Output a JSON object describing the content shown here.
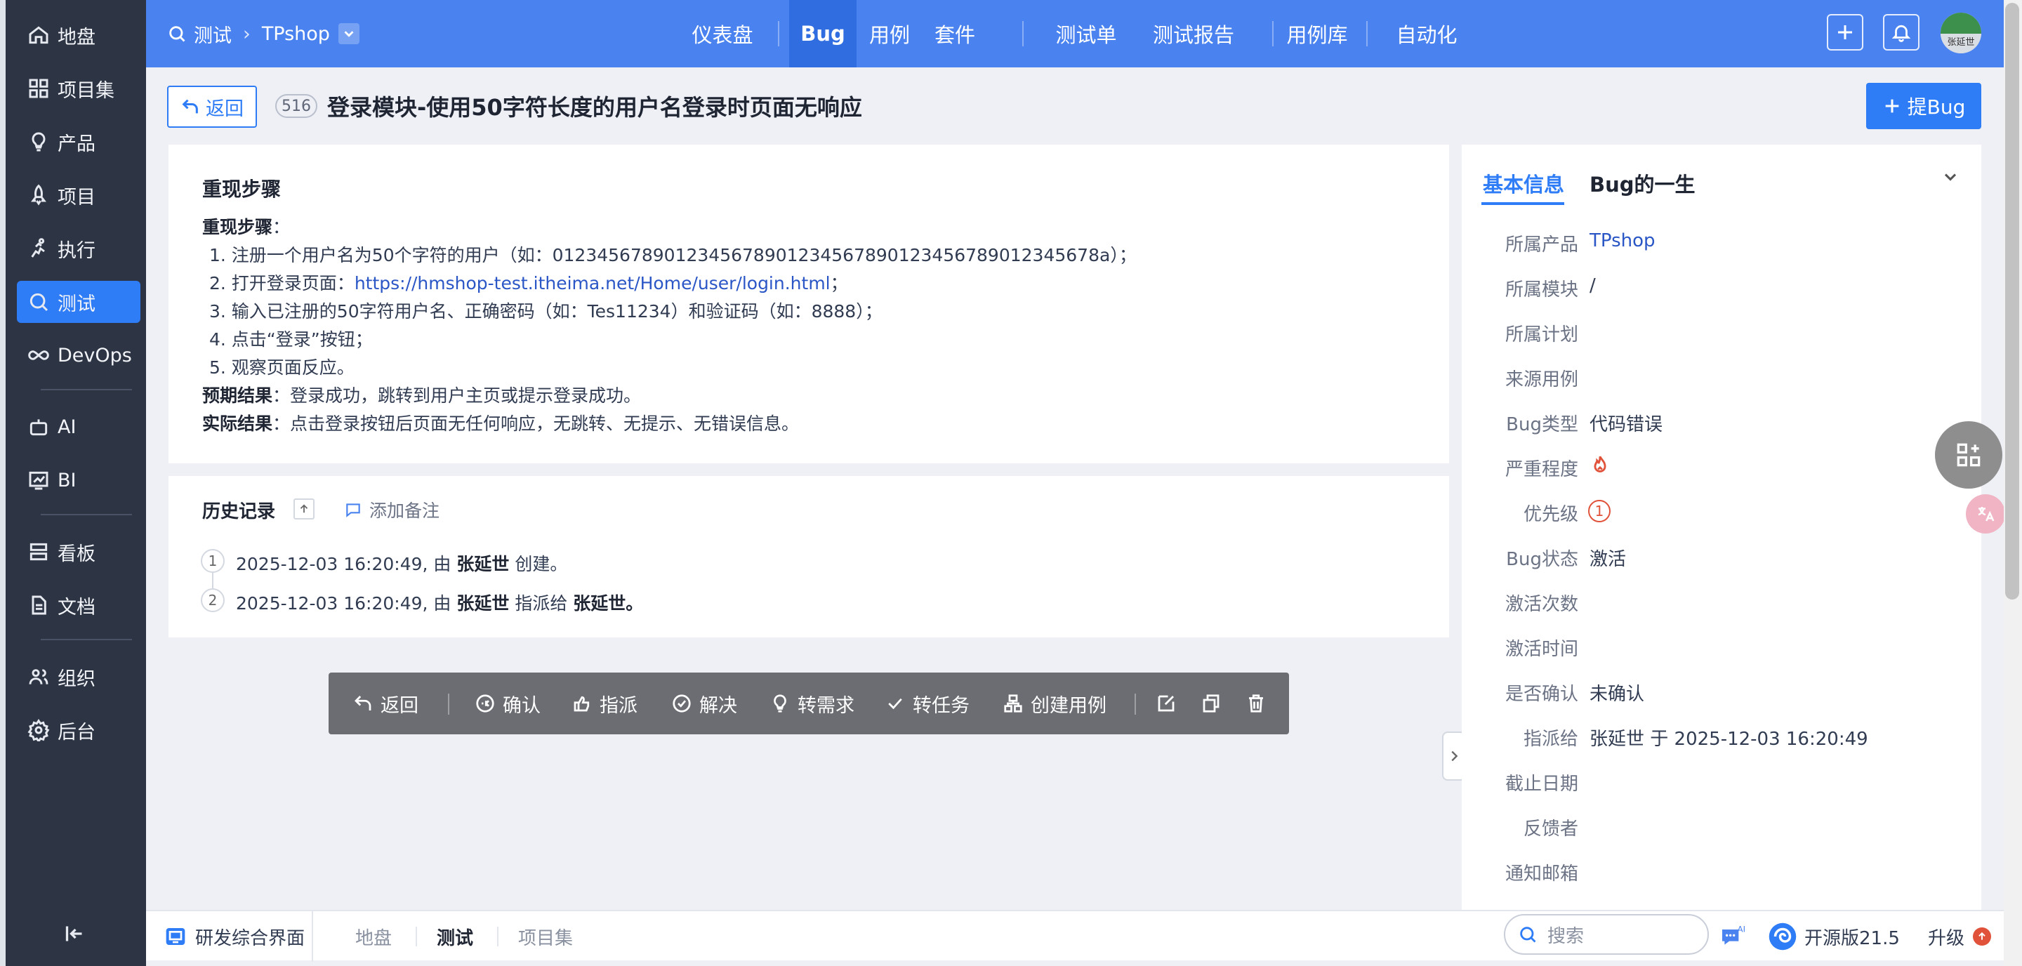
{
  "sidebar": {
    "items": [
      {
        "label": "地盘",
        "icon": "home-icon"
      },
      {
        "label": "项目集",
        "icon": "grid-icon"
      },
      {
        "label": "产品",
        "icon": "lightbulb-icon"
      },
      {
        "label": "项目",
        "icon": "rocket-icon"
      },
      {
        "label": "执行",
        "icon": "run-icon"
      },
      {
        "label": "测试",
        "icon": "search-icon",
        "active": true
      },
      {
        "label": "DevOps",
        "icon": "infinity-icon"
      },
      {
        "label": "AI",
        "icon": "robot-icon"
      },
      {
        "label": "BI",
        "icon": "chart-icon"
      },
      {
        "label": "看板",
        "icon": "kanban-icon"
      },
      {
        "label": "文档",
        "icon": "document-icon"
      },
      {
        "label": "组织",
        "icon": "people-icon"
      },
      {
        "label": "后台",
        "icon": "gear-icon"
      }
    ]
  },
  "topbar": {
    "section": "测试",
    "product": "TPshop",
    "nav": [
      "仪表盘",
      "Bug",
      "用例",
      "套件",
      "测试单",
      "测试报告",
      "用例库",
      "自动化"
    ],
    "active_nav": "Bug",
    "avatar_text": "张延世"
  },
  "bug": {
    "back_label": "返回",
    "id": "516",
    "title": "登录模块-使用50字符长度的用户名登录时页面无响应",
    "report_label": "提Bug"
  },
  "steps": {
    "section_title": "重现步骤",
    "heading_label": "重现步骤",
    "items": [
      "1. 注册一个用户名为50个字符的用户（如：0123456789012345678901234567890123456789012345678a）；",
      "2. 打开登录页面：",
      "3. 输入已注册的50字符用户名、正确密码（如：Tes11234）和验证码（如：8888）；",
      "4. 点击“登录”按钮；",
      "5. 观察页面反应。"
    ],
    "login_url": "https://hmshop-test.itheima.net/Home/user/login.html",
    "url_suffix": "；",
    "expected_label": "预期结果",
    "expected": "：登录成功，跳转到用户主页或提示登录成功。",
    "actual_label": "实际结果",
    "actual": "：点击登录按钮后页面无任何响应，无跳转、无提示、无错误信息。"
  },
  "history": {
    "title": "历史记录",
    "add_note": "添加备注",
    "entries": [
      {
        "num": "1",
        "time": "2025-12-03 16:20:49, 由 ",
        "user": "张延世",
        "action": " 创建。",
        "target": ""
      },
      {
        "num": "2",
        "time": "2025-12-03 16:20:49, 由 ",
        "user": "张延世",
        "action": " 指派给 ",
        "target": "张延世。"
      }
    ]
  },
  "actions": [
    "返回",
    "确认",
    "指派",
    "解决",
    "转需求",
    "转任务",
    "创建用例"
  ],
  "info": {
    "tabs": [
      "基本信息",
      "Bug的一生"
    ],
    "fields": [
      {
        "label": "所属产品",
        "value": "TPshop",
        "link": true
      },
      {
        "label": "所属模块",
        "value": "/"
      },
      {
        "label": "所属计划",
        "value": ""
      },
      {
        "label": "来源用例",
        "value": ""
      },
      {
        "label": "Bug类型",
        "value": "代码错误"
      },
      {
        "label": "严重程度",
        "value": ""
      },
      {
        "label": "优先级",
        "value": "1"
      },
      {
        "label": "Bug状态",
        "value": "激活"
      },
      {
        "label": "激活次数",
        "value": ""
      },
      {
        "label": "激活时间",
        "value": ""
      },
      {
        "label": "是否确认",
        "value": "未确认"
      },
      {
        "label": "指派给",
        "value": "张延世 于 2025-12-03 16:20:49"
      },
      {
        "label": "截止日期",
        "value": ""
      },
      {
        "label": "反馈者",
        "value": ""
      },
      {
        "label": "通知邮箱",
        "value": ""
      }
    ]
  },
  "bottombar": {
    "app_name": "研发综合界面",
    "tabs": [
      "地盘",
      "测试",
      "项目集"
    ],
    "active_tab": "测试",
    "search_placeholder": "搜索",
    "edition": "开源版21.5",
    "upgrade": "升级"
  },
  "colors": {
    "primary": "#2e7cf6",
    "topbar": "#4a83f0",
    "sidebar": "#2d3545",
    "danger": "#e0533a"
  }
}
